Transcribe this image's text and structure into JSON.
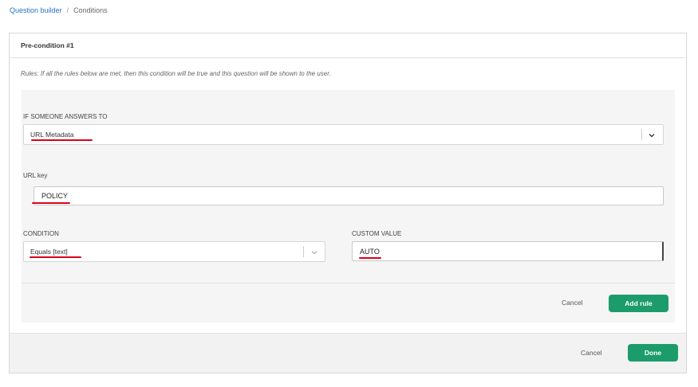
{
  "breadcrumb": {
    "parent": "Question builder",
    "separator": "/",
    "current": "Conditions"
  },
  "panel": {
    "title": "Pre-condition #1",
    "rules_text": "Rules: If all the rules below are met, then this condition will be true and this question will be shown to the user."
  },
  "rule": {
    "answer_label": "IF SOMEONE ANSWERS TO",
    "answer_value": "URL Metadata",
    "url_key_label": "URL key",
    "url_key_value": "POLICY",
    "condition_label": "CONDITION",
    "condition_value": "Equals [text]",
    "custom_value_label": "CUSTOM VALUE",
    "custom_value_value": "AUTO",
    "cancel_label": "Cancel",
    "add_rule_label": "Add rule"
  },
  "footer": {
    "cancel_label": "Cancel",
    "done_label": "Done"
  },
  "colors": {
    "accent_green": "#1c9c6b",
    "link_blue": "#2a74c5",
    "annotation_red": "#d9001b"
  }
}
